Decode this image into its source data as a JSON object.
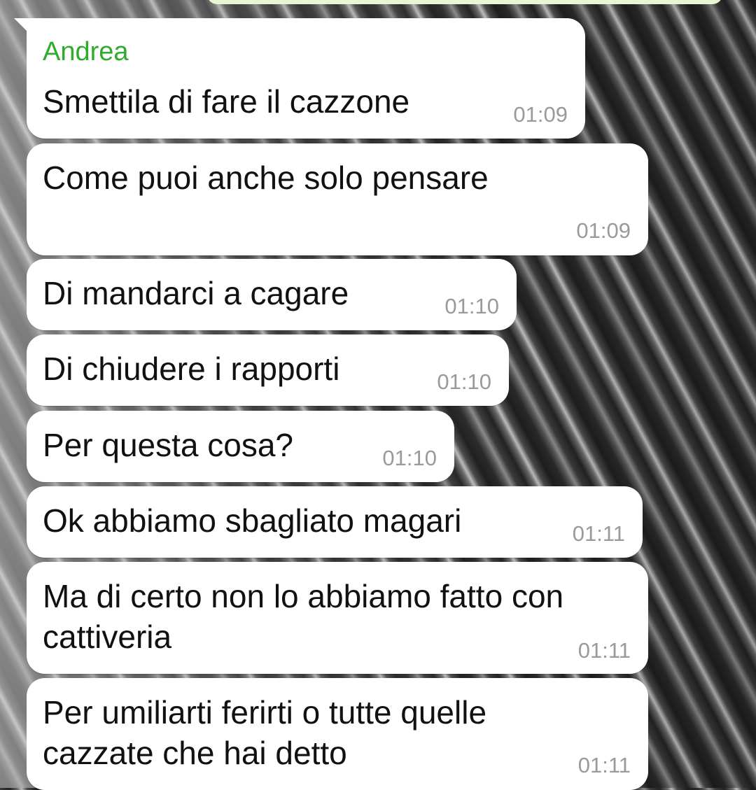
{
  "chat": {
    "messages": [
      {
        "sender": "Andrea",
        "lines": [
          "Smettila di fare il cazzone"
        ],
        "time": "01:09"
      },
      {
        "lines": [
          "Come puoi anche solo pensare"
        ],
        "time": "01:09"
      },
      {
        "lines": [
          "Di mandarci a cagare"
        ],
        "time": "01:10"
      },
      {
        "lines": [
          "Di chiudere i rapporti"
        ],
        "time": "01:10"
      },
      {
        "lines": [
          "Per questa cosa?"
        ],
        "time": "01:10"
      },
      {
        "lines": [
          "Ok abbiamo sbagliato magari"
        ],
        "time": "01:11"
      },
      {
        "lines": [
          "Ma di certo non lo abbiamo fatto con",
          "cattiveria"
        ],
        "time": "01:11"
      },
      {
        "lines": [
          "Per umiliarti ferirti o tutte quelle",
          "cazzate che hai detto"
        ],
        "time": "01:11"
      }
    ]
  },
  "colors": {
    "incoming_bubble": "#ffffff",
    "outgoing_bubble": "#e6f7d3",
    "sender_name": "#2fac2e",
    "timestamp": "#9a9a9a"
  }
}
